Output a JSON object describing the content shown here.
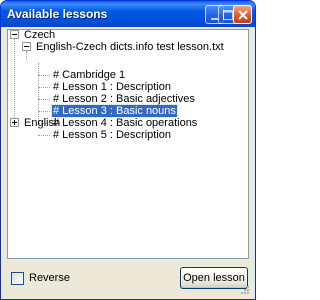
{
  "window": {
    "title": "Available lessons",
    "buttons": {
      "minimize": "minimize-icon",
      "maximize": "maximize-icon",
      "close": "close-icon"
    }
  },
  "tree": {
    "nodes": [
      {
        "label": "Czech",
        "expanded": true
      },
      {
        "label": "English-Czech dicts.info test lesson.txt",
        "expanded": true
      },
      {
        "label": "# Cambridge 1"
      },
      {
        "label": "# Lesson 1 : Description"
      },
      {
        "label": "# Lesson 2 : Basic adjectives"
      },
      {
        "label": "# Lesson 3 : Basic nouns",
        "selected": true
      },
      {
        "label": "# Lesson 4 : Basic operations"
      },
      {
        "label": "# Lesson 5 : Description"
      },
      {
        "label": "English",
        "expanded": false
      }
    ]
  },
  "footer": {
    "reverse_label": "Reverse",
    "reverse_checked": false,
    "open_button": "Open lesson"
  },
  "colors": {
    "titlebar": "#0058e6",
    "selection": "#316ac5",
    "close_button": "#e25a30",
    "window_bg": "#ece9d8"
  }
}
